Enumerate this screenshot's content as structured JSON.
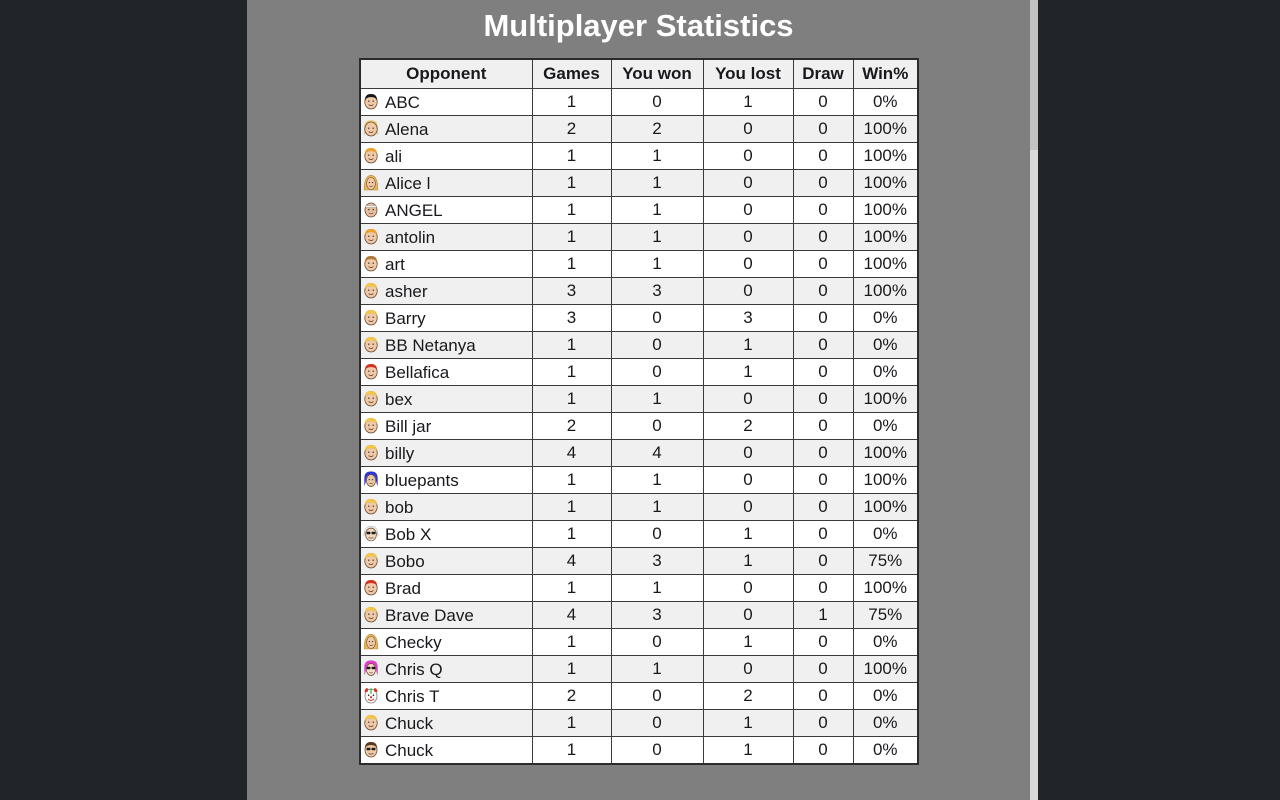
{
  "window": {
    "background_color": "#212429",
    "page_background_color": "#7f7f7f"
  },
  "header": {
    "title": "Multiplayer Statistics",
    "title_color": "#ffffff"
  },
  "table": {
    "columns": [
      "Opponent",
      "Games",
      "You won",
      "You lost",
      "Draw",
      "Win%"
    ],
    "rows": [
      {
        "avatar": "avatar-dark-hair-face",
        "opponent": "ABC",
        "games": "1",
        "won": "0",
        "lost": "1",
        "draw": "0",
        "winpct": "0%"
      },
      {
        "avatar": "avatar-blonde-long-hair-face",
        "opponent": "Alena",
        "games": "2",
        "won": "2",
        "lost": "0",
        "draw": "0",
        "winpct": "100%"
      },
      {
        "avatar": "avatar-orange-hair-face",
        "opponent": "ali",
        "games": "1",
        "won": "1",
        "lost": "0",
        "draw": "0",
        "winpct": "100%"
      },
      {
        "avatar": "avatar-blonde-hood-face",
        "opponent": "Alice l",
        "games": "1",
        "won": "1",
        "lost": "0",
        "draw": "0",
        "winpct": "100%"
      },
      {
        "avatar": "avatar-bald-glasses-face",
        "opponent": "ANGEL",
        "games": "1",
        "won": "1",
        "lost": "0",
        "draw": "0",
        "winpct": "100%"
      },
      {
        "avatar": "avatar-orange-hair-face",
        "opponent": "antolin",
        "games": "1",
        "won": "1",
        "lost": "0",
        "draw": "0",
        "winpct": "100%"
      },
      {
        "avatar": "avatar-brown-hair-face",
        "opponent": "art",
        "games": "1",
        "won": "1",
        "lost": "0",
        "draw": "0",
        "winpct": "100%"
      },
      {
        "avatar": "avatar-blonde-hair-face",
        "opponent": "asher",
        "games": "3",
        "won": "3",
        "lost": "0",
        "draw": "0",
        "winpct": "100%"
      },
      {
        "avatar": "avatar-blonde-hair-face",
        "opponent": "Barry",
        "games": "3",
        "won": "0",
        "lost": "3",
        "draw": "0",
        "winpct": "0%"
      },
      {
        "avatar": "avatar-blonde-hair-face",
        "opponent": "BB Netanya",
        "games": "1",
        "won": "0",
        "lost": "1",
        "draw": "0",
        "winpct": "0%"
      },
      {
        "avatar": "avatar-red-hair-face",
        "opponent": "Bellafica",
        "games": "1",
        "won": "0",
        "lost": "1",
        "draw": "0",
        "winpct": "0%"
      },
      {
        "avatar": "avatar-blonde-hair-face",
        "opponent": "bex",
        "games": "1",
        "won": "1",
        "lost": "0",
        "draw": "0",
        "winpct": "100%"
      },
      {
        "avatar": "avatar-blonde-hair-face",
        "opponent": "Bill jar",
        "games": "2",
        "won": "0",
        "lost": "2",
        "draw": "0",
        "winpct": "0%"
      },
      {
        "avatar": "avatar-blonde-hair-face",
        "opponent": "billy",
        "games": "4",
        "won": "4",
        "lost": "0",
        "draw": "0",
        "winpct": "100%"
      },
      {
        "avatar": "avatar-blue-hair-face",
        "opponent": "bluepants",
        "games": "1",
        "won": "1",
        "lost": "0",
        "draw": "0",
        "winpct": "100%"
      },
      {
        "avatar": "avatar-blonde-hair-face",
        "opponent": "bob",
        "games": "1",
        "won": "1",
        "lost": "0",
        "draw": "0",
        "winpct": "100%"
      },
      {
        "avatar": "avatar-white-hair-sunglasses-face",
        "opponent": "Bob X",
        "games": "1",
        "won": "0",
        "lost": "1",
        "draw": "0",
        "winpct": "0%"
      },
      {
        "avatar": "avatar-blonde-hair-face",
        "opponent": "Bobo",
        "games": "4",
        "won": "3",
        "lost": "1",
        "draw": "0",
        "winpct": "75%"
      },
      {
        "avatar": "avatar-red-hair-face",
        "opponent": "Brad",
        "games": "1",
        "won": "1",
        "lost": "0",
        "draw": "0",
        "winpct": "100%"
      },
      {
        "avatar": "avatar-blonde-hair-face",
        "opponent": "Brave Dave",
        "games": "4",
        "won": "3",
        "lost": "0",
        "draw": "1",
        "winpct": "75%"
      },
      {
        "avatar": "avatar-blonde-hood-face",
        "opponent": "Checky",
        "games": "1",
        "won": "0",
        "lost": "1",
        "draw": "0",
        "winpct": "0%"
      },
      {
        "avatar": "avatar-pink-hair-sunglasses-face",
        "opponent": "Chris Q",
        "games": "1",
        "won": "1",
        "lost": "0",
        "draw": "0",
        "winpct": "100%"
      },
      {
        "avatar": "avatar-clown-face",
        "opponent": "Chris T",
        "games": "2",
        "won": "0",
        "lost": "2",
        "draw": "0",
        "winpct": "0%"
      },
      {
        "avatar": "avatar-blonde-hair-face",
        "opponent": "Chuck",
        "games": "1",
        "won": "0",
        "lost": "1",
        "draw": "0",
        "winpct": "0%"
      },
      {
        "avatar": "avatar-brown-hair-sunglasses-face",
        "opponent": "Chuck",
        "games": "1",
        "won": "0",
        "lost": "1",
        "draw": "0",
        "winpct": "0%"
      }
    ]
  }
}
